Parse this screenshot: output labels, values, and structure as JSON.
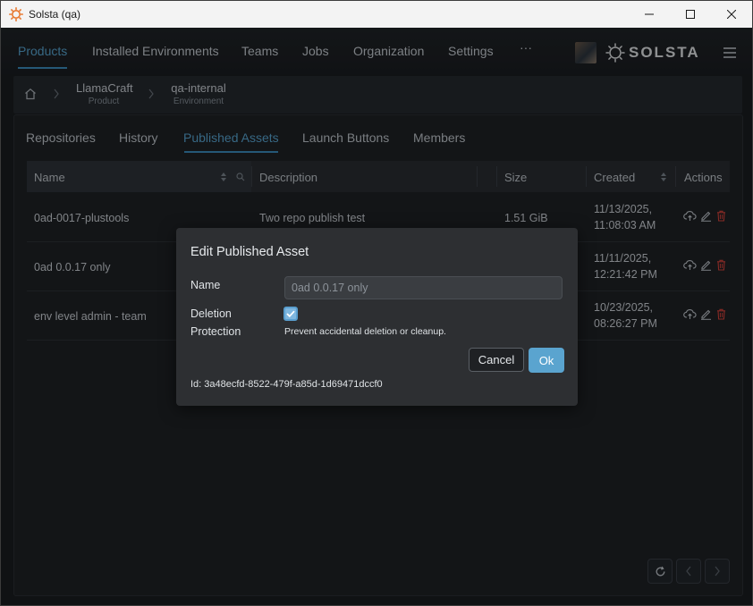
{
  "window": {
    "title": "Solsta (qa)"
  },
  "nav": {
    "items": [
      "Products",
      "Installed Environments",
      "Teams",
      "Jobs",
      "Organization",
      "Settings",
      "···"
    ],
    "logo_text": "SOLSTA"
  },
  "breadcrumb": {
    "items": [
      {
        "label": "LlamaCraft",
        "sublabel": "Product"
      },
      {
        "label": "qa-internal",
        "sublabel": "Environment"
      }
    ]
  },
  "tabs": [
    "Repositories",
    "History",
    "Published Assets",
    "Launch Buttons",
    "Members"
  ],
  "table": {
    "columns": {
      "name": "Name",
      "description": "Description",
      "size": "Size",
      "created": "Created",
      "actions": "Actions"
    },
    "rows": [
      {
        "name": "0ad-0017-plustools",
        "description": "Two repo publish test",
        "size": "1.51 GiB",
        "created_date": "11/13/2025,",
        "created_time": "11:08:03 AM"
      },
      {
        "name": "0ad 0.0.17 only",
        "description": "",
        "size": "",
        "created_date": "11/11/2025,",
        "created_time": "12:21:42 PM"
      },
      {
        "name": "env level admin - team",
        "description": "",
        "size": "",
        "created_date": "10/23/2025,",
        "created_time": "08:26:27 PM"
      }
    ]
  },
  "modal": {
    "title": "Edit Published Asset",
    "name_label": "Name",
    "name_value": "0ad 0.0.17 only",
    "deletion_label_1": "Deletion",
    "deletion_label_2": "Protection",
    "deletion_checked": true,
    "deletion_hint": "Prevent accidental deletion or cleanup.",
    "cancel_label": "Cancel",
    "ok_label": "Ok",
    "id_text": "Id: 3a48ecfd-8522-479f-a85d-1d69471dccf0"
  },
  "colors": {
    "accent": "#5aa8d6",
    "delete": "#d9443c",
    "background": "#1a1d21"
  }
}
